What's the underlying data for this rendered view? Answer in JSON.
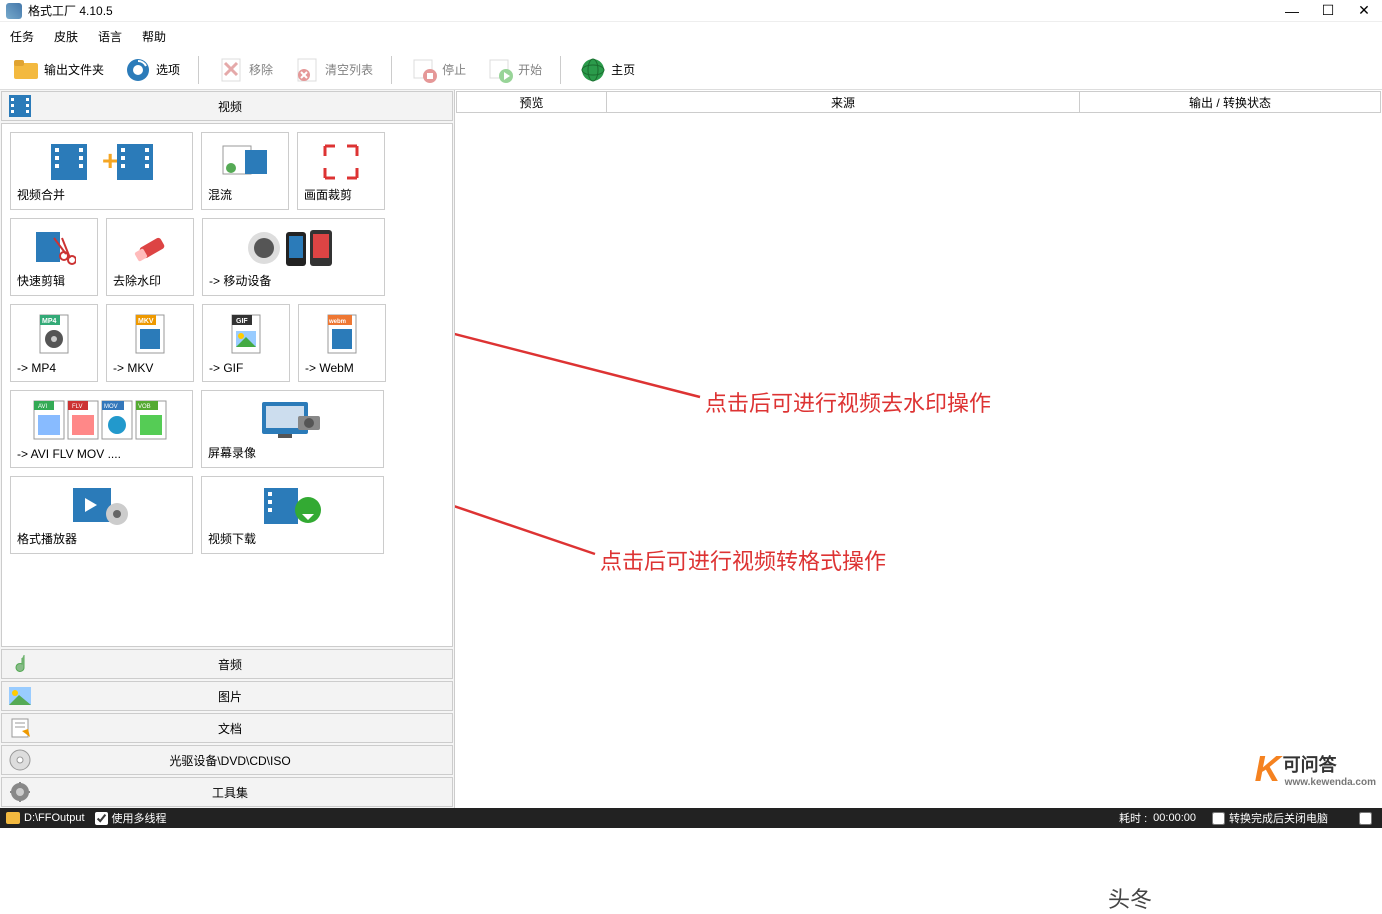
{
  "app": {
    "title": "格式工厂 4.10.5"
  },
  "menu": {
    "task": "任务",
    "skin": "皮肤",
    "language": "语言",
    "help": "帮助"
  },
  "toolbar": {
    "output_folder": "输出文件夹",
    "options": "选项",
    "remove": "移除",
    "clear_list": "清空列表",
    "stop": "停止",
    "start": "开始",
    "home": "主页"
  },
  "categories": {
    "video": "视频",
    "audio": "音频",
    "image": "图片",
    "document": "文档",
    "disc": "光驱设备\\DVD\\CD\\ISO",
    "tools": "工具集"
  },
  "video_items": {
    "merge": "视频合并",
    "mux": "混流",
    "crop": "画面裁剪",
    "quick_cut": "快速剪辑",
    "remove_wm": "去除水印",
    "mobile": "-> 移动设备",
    "mp4": "-> MP4",
    "mkv": "-> MKV",
    "gif": "-> GIF",
    "webm": "-> WebM",
    "avi_flv": "-> AVI FLV MOV ....",
    "screen_rec": "屏幕录像",
    "player": "格式播放器",
    "download": "视频下载"
  },
  "table": {
    "preview": "预览",
    "source": "来源",
    "output_status": "输出 / 转换状态"
  },
  "status": {
    "output_path": "D:\\FFOutput",
    "multithread": "使用多线程",
    "elapsed_label": "耗时 :",
    "elapsed_value": "00:00:00"
  },
  "annotations": {
    "a1": "点击后可进行视频去水印操作",
    "a2": "点击后可进行视频转格式操作"
  },
  "watermark": {
    "brand": "可问答",
    "url": "www.kewenda.com",
    "header": "头冬"
  }
}
